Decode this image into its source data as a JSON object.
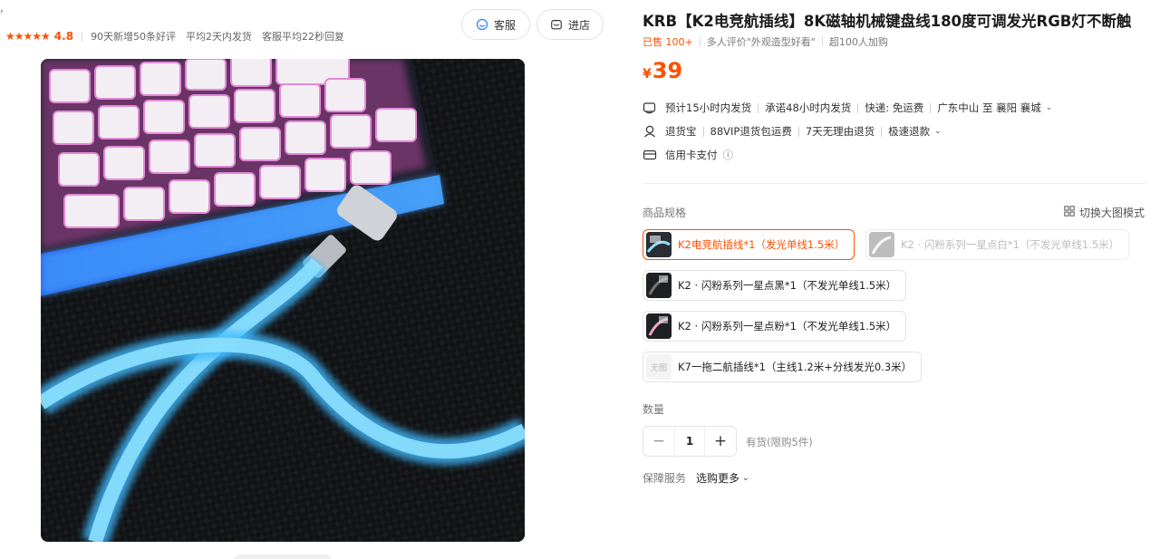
{
  "shop": {
    "arrow_glyph": "›",
    "stars": "★★★★★",
    "rating": "4.8",
    "stats": [
      "90天新增50条好评",
      "平均2天内发货",
      "客服平均22秒回复"
    ],
    "service_button": "客服",
    "store_button": "进店"
  },
  "product": {
    "title": "KRB【K2电竞航插线】8K磁轴机械键盘线180度可调发光RGB灯不断触",
    "sold": "已售 100+",
    "review_highlight": "多人评价\"外观造型好看\"",
    "cart_count": "超100人加购",
    "price_symbol": "¥",
    "price_value": "39"
  },
  "shipping": {
    "estimate": "预计15小时内发货",
    "promise": "承诺48小时内发货",
    "fee": "快递: 免运费",
    "route": "广东中山 至 襄阳 襄城"
  },
  "returns": {
    "name": "退货宝",
    "vip": "88VIP退货包运费",
    "seven_day": "7天无理由退货",
    "fast_refund": "极速退款"
  },
  "payment": {
    "credit": "信用卡支付",
    "info_icon": "ⓘ"
  },
  "specs": {
    "label": "商品规格",
    "toggle_label": "切换大图模式",
    "options": [
      {
        "label": "K2电竞航插线*1（发光单线1.5米）",
        "state": "selected"
      },
      {
        "label": "K2 · 闪粉系列一星点白*1（不发光单线1.5米）",
        "state": "disabled"
      },
      {
        "label": "K2 · 闪粉系列一星点黑*1（不发光单线1.5米）",
        "state": "normal"
      },
      {
        "label": "K2 · 闪粉系列一星点粉*1（不发光单线1.5米）",
        "state": "normal"
      },
      {
        "label": "K7一拖二航插线*1（主线1.2米+分线发光0.3米）",
        "state": "normal",
        "thumb_text": "无图"
      }
    ]
  },
  "quantity": {
    "label": "数量",
    "minus": "−",
    "value": "1",
    "plus": "+",
    "stock": "有货(限购5件)"
  },
  "guarantee": {
    "label": "保障服务",
    "more": "选购更多",
    "chevron": "⌄"
  },
  "colors": {
    "accent": "#ff5000"
  }
}
